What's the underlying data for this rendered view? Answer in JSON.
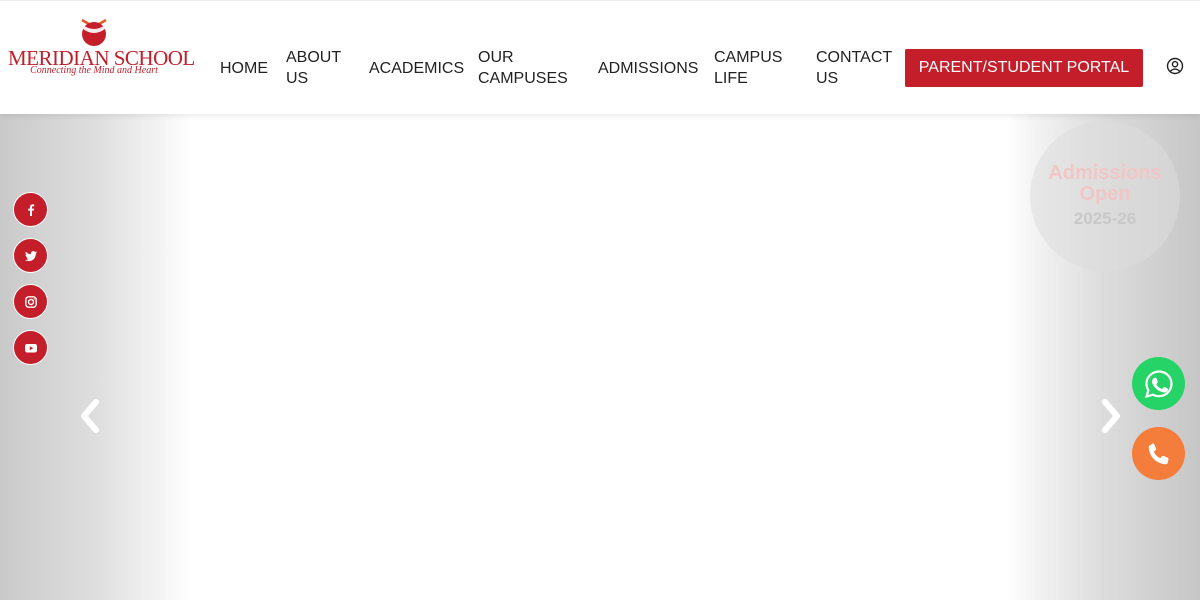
{
  "brand": {
    "name": "MERIDIAN SCHOOL",
    "tagline": "Connecting the Mind and Heart",
    "color": "#c41e2a"
  },
  "nav": {
    "items": [
      {
        "label": "HOME"
      },
      {
        "label": "ABOUT US"
      },
      {
        "label": "ACADEMICS"
      },
      {
        "label": "OUR CAMPUSES"
      },
      {
        "label": "ADMISSIONS"
      },
      {
        "label": "CAMPUS LIFE"
      },
      {
        "label": "CONTACT US"
      }
    ],
    "portal_label": "PARENT/STUDENT PORTAL",
    "user_icon": "user-circle-icon"
  },
  "hero": {
    "badge": {
      "line1": "Admissions",
      "line2": "Open",
      "year": "2025-26"
    },
    "prev_icon": "chevron-left-icon",
    "next_icon": "chevron-right-icon"
  },
  "social": [
    {
      "name": "facebook-icon"
    },
    {
      "name": "twitter-icon"
    },
    {
      "name": "instagram-icon"
    },
    {
      "name": "youtube-icon"
    }
  ],
  "floating": {
    "whatsapp_color": "#25d366",
    "phone_color": "#f47d3c"
  }
}
